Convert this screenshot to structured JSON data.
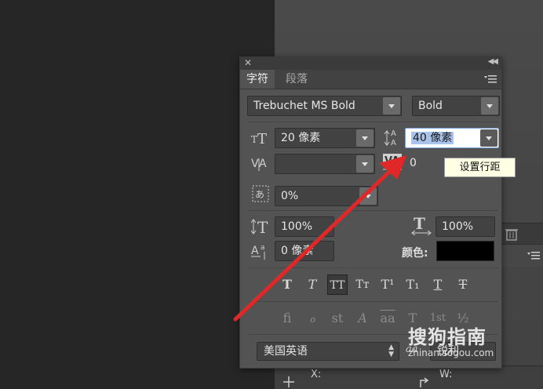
{
  "panel": {
    "tabs": [
      {
        "label": "字符",
        "active": true
      },
      {
        "label": "段落",
        "active": false
      }
    ]
  },
  "font": {
    "family": "Trebuchet MS Bold",
    "style": "Bold"
  },
  "size": {
    "font_size": "20 像素",
    "leading": "40 像素",
    "kerning": "",
    "tracking": "0",
    "tsume": "0%",
    "vertical_scale": "100%",
    "horizontal_scale": "100%",
    "baseline_shift": "0 像素",
    "color_label": "颜色:",
    "color_value": "#000000"
  },
  "tooltip": "设置行距",
  "type_buttons": [
    "T",
    "T",
    "TT",
    "Tᴛ",
    "T¹",
    "T₁",
    "T",
    "T"
  ],
  "opentype_buttons": [
    "fi",
    "ℴ",
    "st",
    "A",
    "aa",
    "T",
    "1st",
    "½"
  ],
  "language": "美国英语",
  "antialias_icon": "aa",
  "antialias": "锐利",
  "bottom": {
    "x_label": "X:",
    "w_label": "W:"
  },
  "watermark": {
    "main": "搜狗指南",
    "sub": "zhinan.sogou.com"
  },
  "colors": {
    "arrow": "#e02828",
    "selection": "#a9c3ea"
  }
}
